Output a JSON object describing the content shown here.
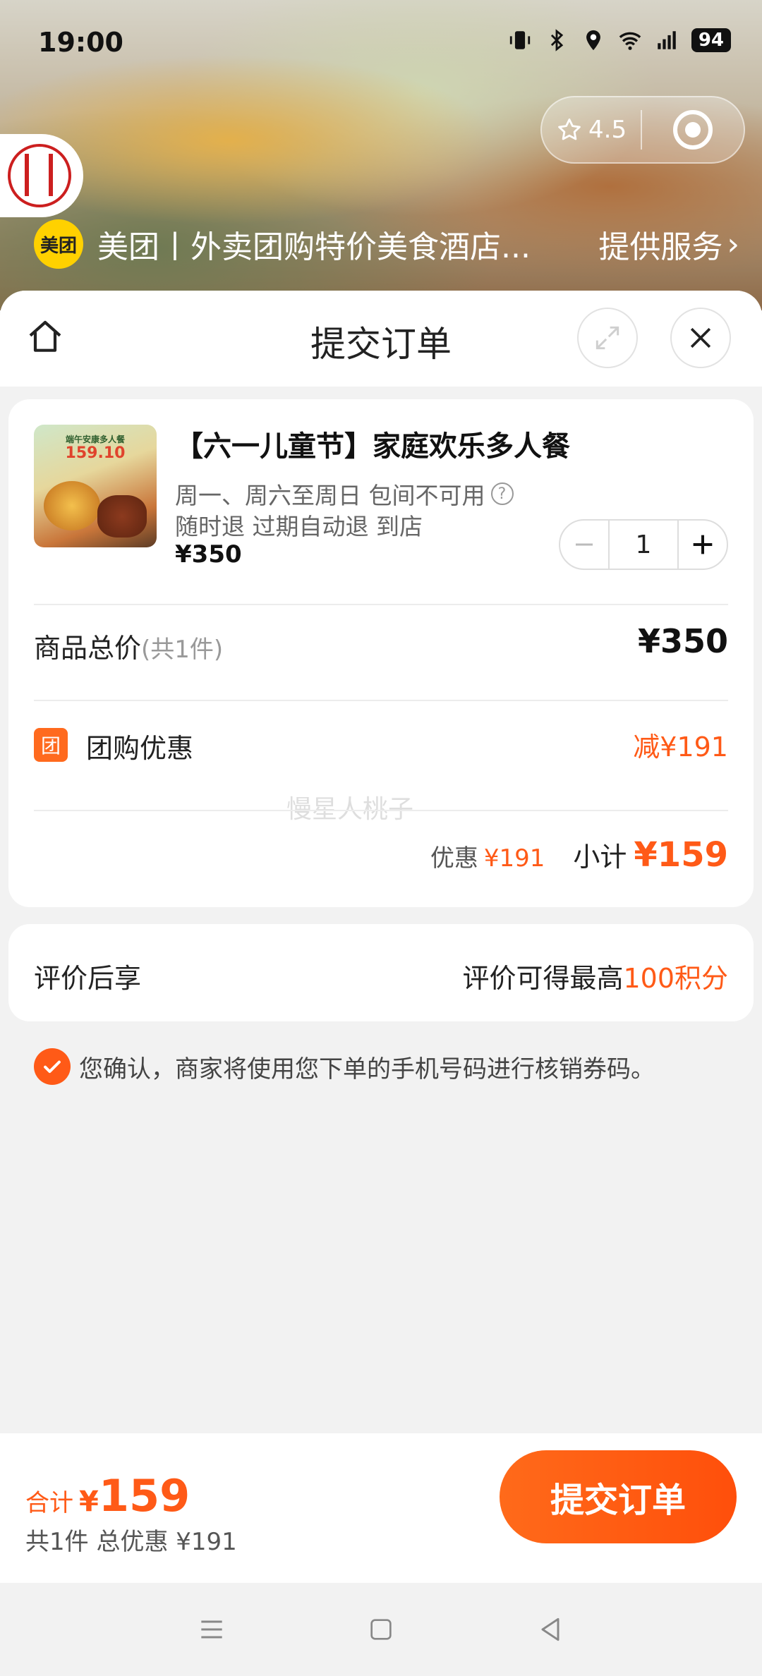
{
  "status_bar": {
    "time": "19:00",
    "battery": "94"
  },
  "capsule": {
    "rating": "4.5"
  },
  "provider": {
    "badge": "美团",
    "title": "美团丨外卖团购特价美食酒店...",
    "service": "提供服务",
    "service_arrow": "›"
  },
  "sheet": {
    "title": "提交订单"
  },
  "product": {
    "title": "【六一儿童节】家庭欢乐多人餐",
    "tags_line1": "周一、周六至周日 包间不可用",
    "tags_line2": "随时退 过期自动退 到店",
    "price": "¥350",
    "quantity": "1",
    "image_text": "端午安康多人餐",
    "image_price": "159.10"
  },
  "summary": {
    "total_label": "商品总价",
    "total_count": "(共1件)",
    "total_price": "¥350",
    "tuangou_icon": "团",
    "tuangou_label": "团购优惠",
    "tuangou_value": "减¥191",
    "watermark": "慢星人桃子",
    "discount_label": "优惠",
    "discount_value": "¥191",
    "subtotal_label": "小计",
    "subtotal_value": "¥159"
  },
  "review": {
    "left": "评价后享",
    "right_prefix": "评价可得最高",
    "right_highlight": "100积分"
  },
  "confirm": {
    "text": "您确认，商家将使用您下单的手机号码进行核销券码。"
  },
  "bottom": {
    "total_label": "合计",
    "yen": "¥",
    "total_amount": "159",
    "sub": "共1件 总优惠 ¥191",
    "submit": "提交订单"
  },
  "colors": {
    "accent": "#ff5a17",
    "meituan_yellow": "#ffd100"
  },
  "icons": [
    "star-icon",
    "target-icon",
    "home-icon",
    "expand-icon",
    "close-icon",
    "question-icon",
    "minus-icon",
    "plus-icon",
    "check-icon",
    "menu-icon",
    "square-icon",
    "back-icon"
  ]
}
